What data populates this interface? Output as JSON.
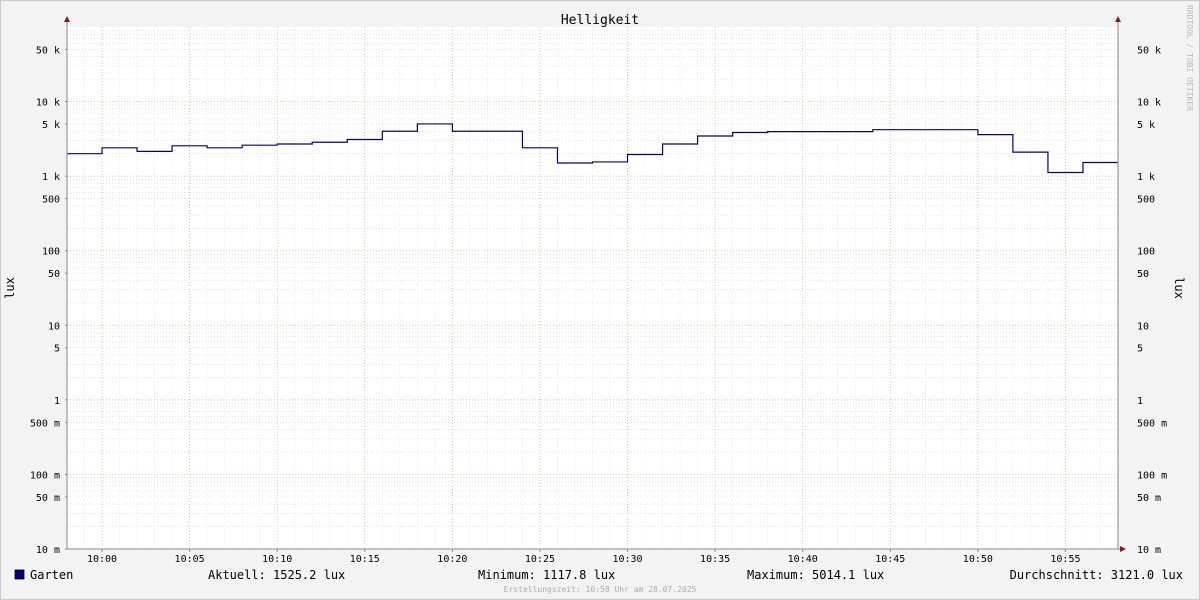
{
  "chart_data": {
    "type": "line",
    "title": "Helligkeit",
    "ylabel": "lux",
    "ylabel_right": "lux",
    "watermark": "RRDTOOL / TOBI OETIKER",
    "y_scale": "log",
    "ylim": [
      0.01,
      100000
    ],
    "y_ticks": [
      {
        "value": 50000,
        "label": "50 k"
      },
      {
        "value": 10000,
        "label": "10 k"
      },
      {
        "value": 5000,
        "label": "5 k"
      },
      {
        "value": 1000,
        "label": "1 k"
      },
      {
        "value": 500,
        "label": "500"
      },
      {
        "value": 100,
        "label": "100"
      },
      {
        "value": 50,
        "label": "50"
      },
      {
        "value": 10,
        "label": "10"
      },
      {
        "value": 5,
        "label": "5"
      },
      {
        "value": 1,
        "label": "1"
      },
      {
        "value": 0.5,
        "label": "500 m"
      },
      {
        "value": 0.1,
        "label": "100 m"
      },
      {
        "value": 0.05,
        "label": "50 m"
      },
      {
        "value": 0.01,
        "label": "10 m"
      }
    ],
    "xlim": [
      "09:58",
      "10:58"
    ],
    "x_ticks": [
      "10:00",
      "10:05",
      "10:10",
      "10:15",
      "10:20",
      "10:25",
      "10:30",
      "10:35",
      "10:40",
      "10:45",
      "10:50",
      "10:55"
    ],
    "grid": true,
    "series": [
      {
        "name": "Garten",
        "color": "#00008b",
        "step": "post",
        "x": [
          "09:58",
          "10:00",
          "10:02",
          "10:04",
          "10:06",
          "10:08",
          "10:10",
          "10:12",
          "10:14",
          "10:16",
          "10:18",
          "10:20",
          "10:22",
          "10:24",
          "10:26",
          "10:28",
          "10:30",
          "10:32",
          "10:34",
          "10:36",
          "10:38",
          "10:40",
          "10:42",
          "10:44",
          "10:46",
          "10:48",
          "10:50",
          "10:52",
          "10:54",
          "10:56",
          "10:58"
        ],
        "y": [
          2000,
          2400,
          2150,
          2550,
          2400,
          2600,
          2700,
          2850,
          3100,
          4000,
          5014.1,
          4000,
          4000,
          2400,
          1500,
          1550,
          1950,
          2700,
          3450,
          3850,
          3950,
          3950,
          3950,
          4200,
          4200,
          4200,
          3600,
          2100,
          1117.8,
          1525.2,
          1525.2
        ]
      }
    ],
    "legend": {
      "placement": "bottom",
      "entries": [
        {
          "name": "Garten",
          "color": "#00008b"
        }
      ],
      "stats": [
        "Aktuell: 1525.2 lux",
        "Minimum: 1117.8 lux",
        "Maximum: 5014.1 lux",
        "Durchschnitt: 3121.0 lux"
      ]
    },
    "footer": "Erstellungszeit: 10:58 Uhr am 28.07.2025"
  }
}
